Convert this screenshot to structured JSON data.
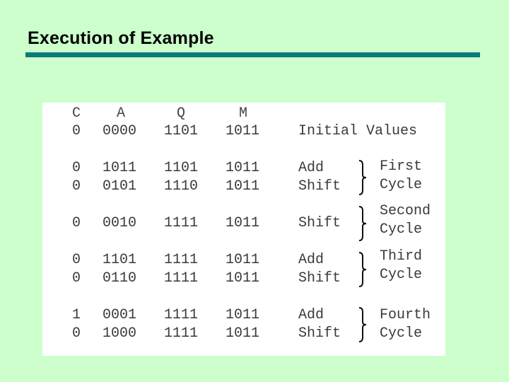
{
  "title": "Execution of Example",
  "columns": [
    "C",
    "A",
    "Q",
    "M"
  ],
  "rows": [
    {
      "C": "0",
      "A": "0000",
      "Q": "1101",
      "M": "1011",
      "op": "Initial Values"
    },
    {
      "C": "0",
      "A": "1011",
      "Q": "1101",
      "M": "1011",
      "op": "Add"
    },
    {
      "C": "0",
      "A": "0101",
      "Q": "1110",
      "M": "1011",
      "op": "Shift"
    },
    {
      "C": "0",
      "A": "0010",
      "Q": "1111",
      "M": "1011",
      "op": "Shift"
    },
    {
      "C": "0",
      "A": "1101",
      "Q": "1111",
      "M": "1011",
      "op": "Add"
    },
    {
      "C": "0",
      "A": "0110",
      "Q": "1111",
      "M": "1011",
      "op": "Shift"
    },
    {
      "C": "1",
      "A": "0001",
      "Q": "1111",
      "M": "1011",
      "op": "Add"
    },
    {
      "C": "0",
      "A": "1000",
      "Q": "1111",
      "M": "1011",
      "op": "Shift"
    }
  ],
  "cycles": [
    {
      "line1": "First",
      "line2": "Cycle"
    },
    {
      "line1": "Second",
      "line2": "Cycle"
    },
    {
      "line1": "Third",
      "line2": "Cycle"
    },
    {
      "line1": "Fourth",
      "line2": "Cycle"
    }
  ]
}
